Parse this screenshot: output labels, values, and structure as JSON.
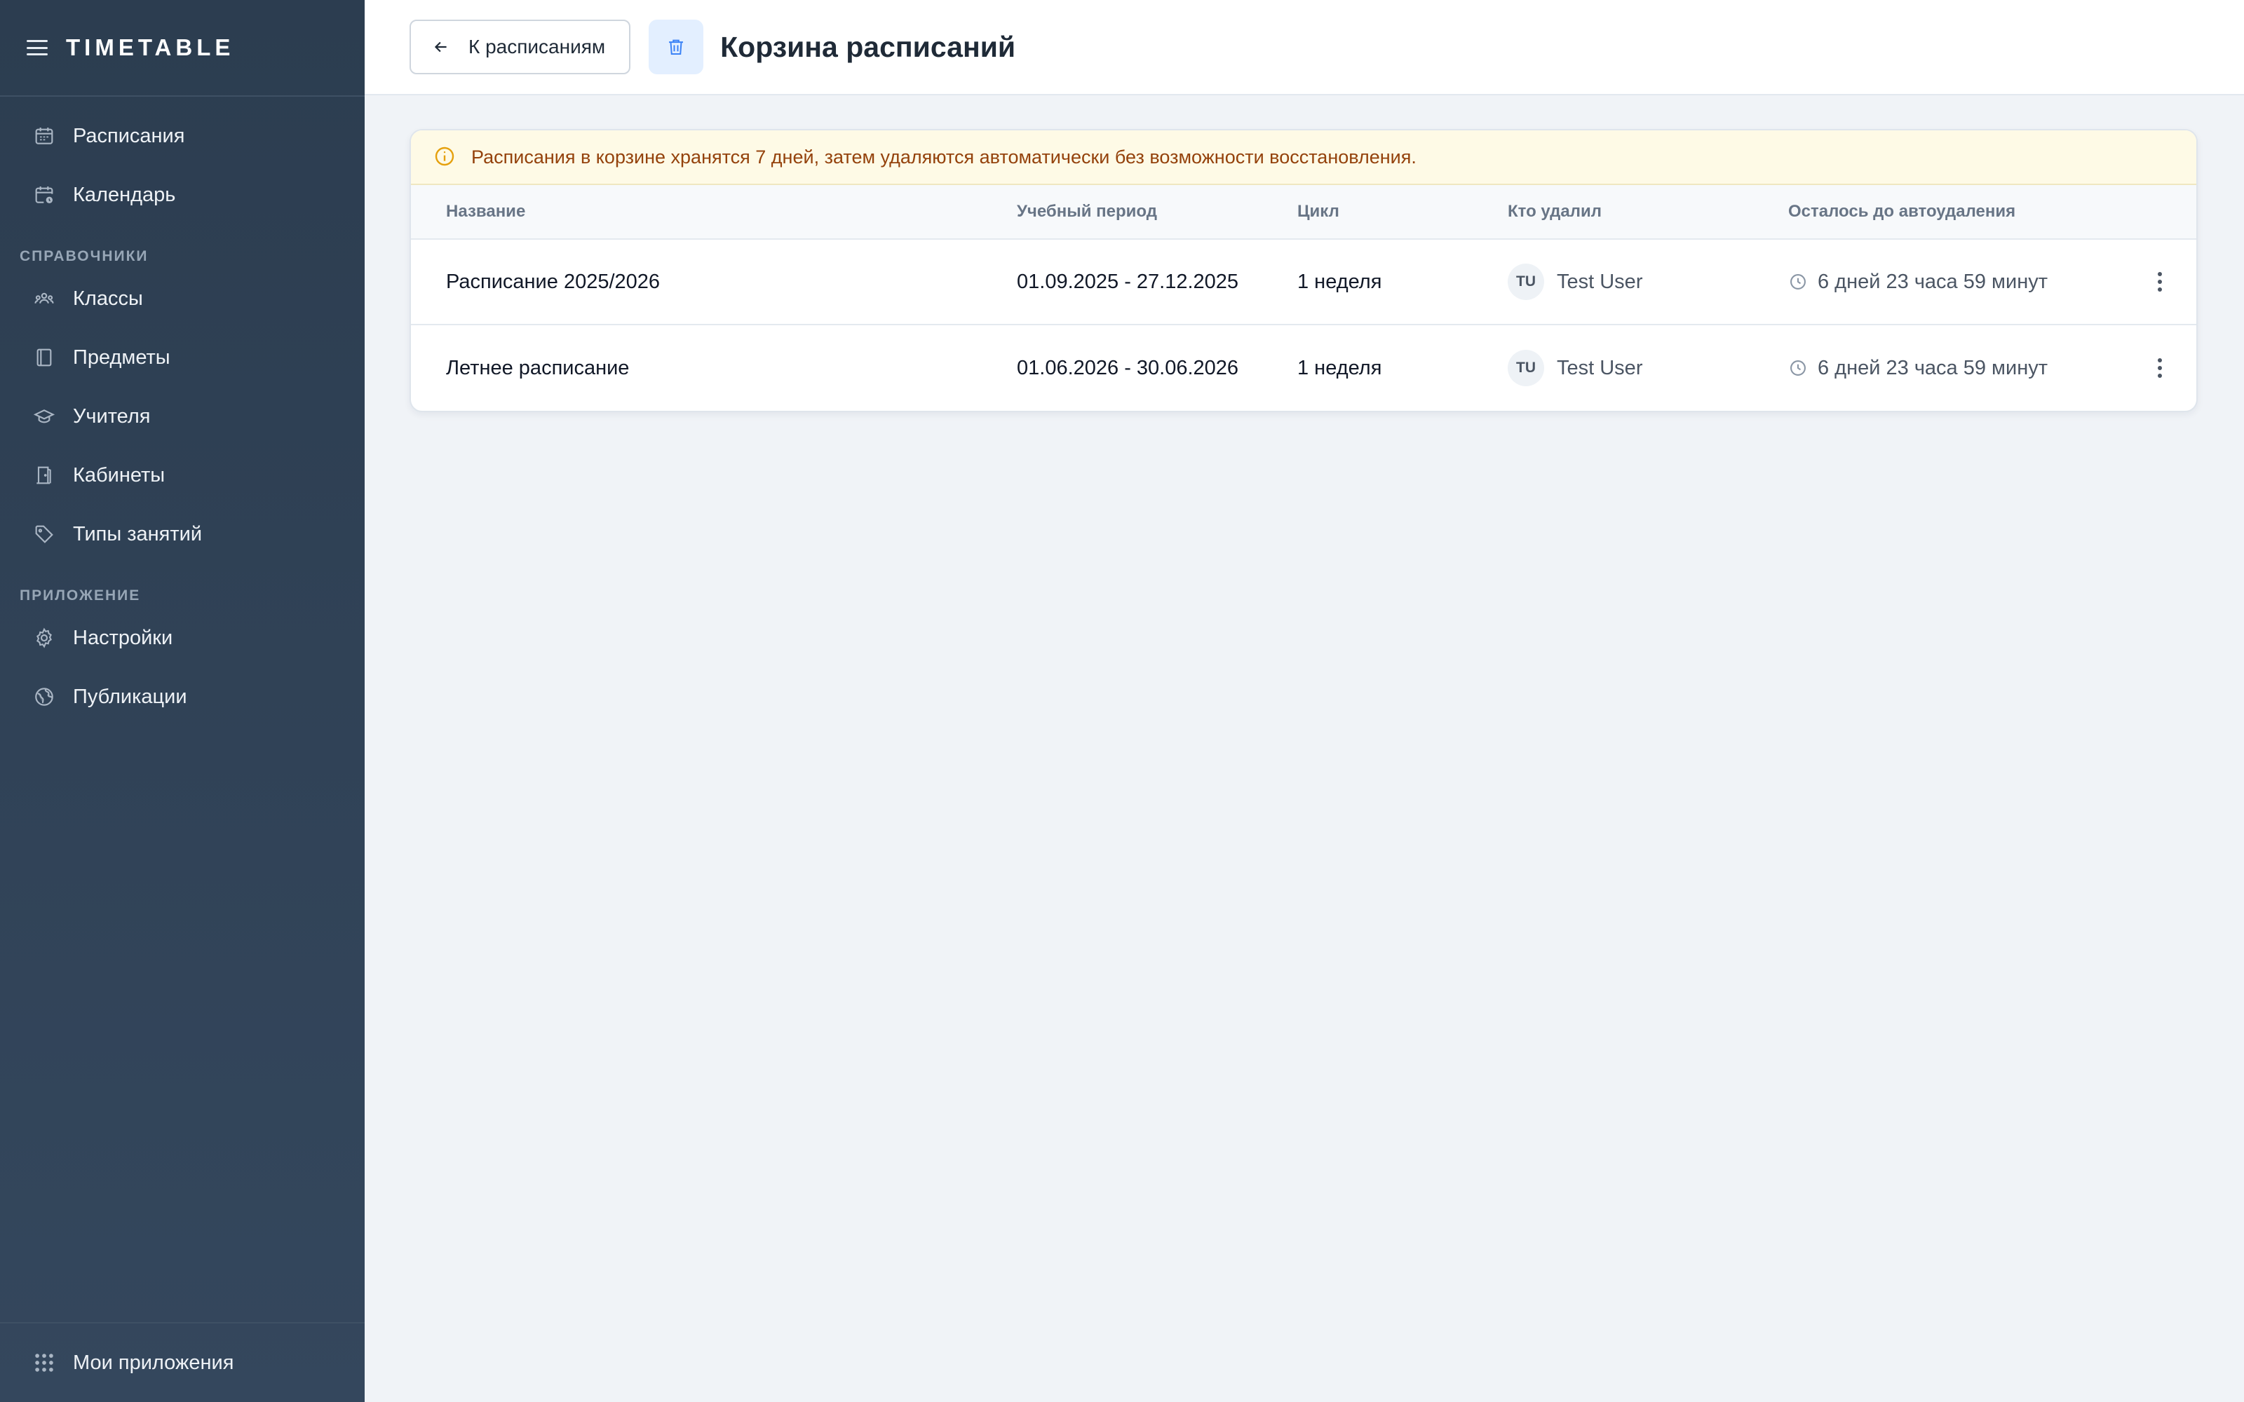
{
  "app": {
    "brand": "TIMETABLE"
  },
  "sidebar": {
    "items_top": [
      {
        "label": "Расписания",
        "icon": "calendar-icon"
      },
      {
        "label": "Календарь",
        "icon": "calendar-clock-icon"
      }
    ],
    "section_refs": "СПРАВОЧНИКИ",
    "items_refs": [
      {
        "label": "Классы",
        "icon": "group-icon"
      },
      {
        "label": "Предметы",
        "icon": "book-icon"
      },
      {
        "label": "Учителя",
        "icon": "graduation-cap-icon"
      },
      {
        "label": "Кабинеты",
        "icon": "door-icon"
      },
      {
        "label": "Типы занятий",
        "icon": "tag-icon"
      }
    ],
    "section_app": "ПРИЛОЖЕНИЕ",
    "items_app": [
      {
        "label": "Настройки",
        "icon": "gear-icon"
      },
      {
        "label": "Публикации",
        "icon": "globe-icon"
      }
    ],
    "footer_label": "Мои приложения"
  },
  "topbar": {
    "back_label": "К расписаниям",
    "title": "Корзина расписаний"
  },
  "notice": "Расписания в корзине хранятся 7 дней, затем удаляются автоматически без возможности восстановления.",
  "table": {
    "columns": [
      "Название",
      "Учебный период",
      "Цикл",
      "Кто удалил",
      "Осталось до автоудаления"
    ],
    "rows": [
      {
        "name": "Расписание 2025/2026",
        "period": "01.09.2025 - 27.12.2025",
        "cycle": "1 неделя",
        "initials": "TU",
        "deleted_by": "Test User",
        "remaining": "6 дней 23 часа 59 минут"
      },
      {
        "name": "Летнее расписание",
        "period": "01.06.2026 - 30.06.2026",
        "cycle": "1 неделя",
        "initials": "TU",
        "deleted_by": "Test User",
        "remaining": "6 дней 23 часа 59 минут"
      }
    ]
  },
  "colors": {
    "sidebar_bg": "#2c3d50",
    "accent_light": "#e3efff",
    "notice_bg": "#fefae6",
    "notice_text": "#94420c",
    "warning_icon": "#e5a00d"
  }
}
